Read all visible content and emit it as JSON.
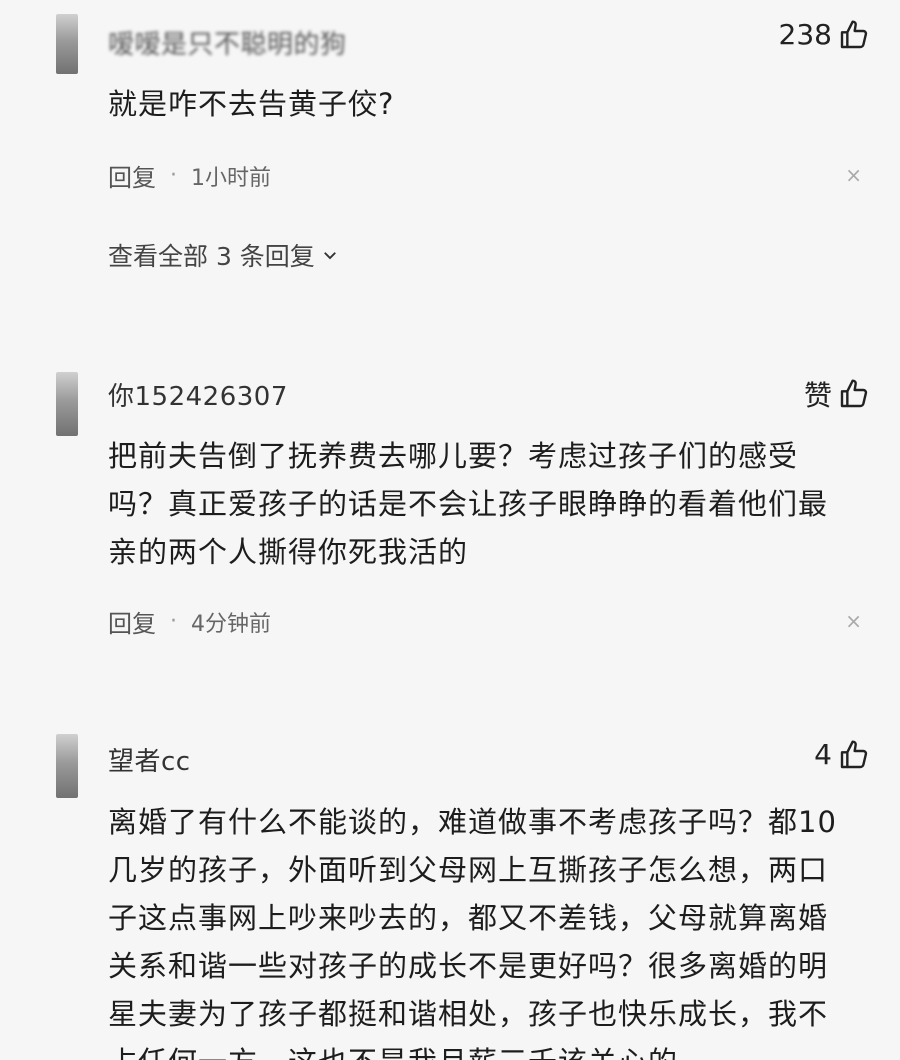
{
  "comments": [
    {
      "username": "嗳嗳是只不聪明的狗",
      "likes": "238",
      "text": "就是咋不去告黄子佼?",
      "reply_label": "回复",
      "time": "1小时前",
      "view_all": "查看全部 3 条回复"
    },
    {
      "username": "你152426307",
      "likes": "赞",
      "text": "把前夫告倒了抚养费去哪儿要？考虑过孩子们的感受吗？真正爱孩子的话是不会让孩子眼睁睁的看着他们最亲的两个人撕得你死我活的",
      "reply_label": "回复",
      "time": "4分钟前"
    },
    {
      "username": "望者cc",
      "likes": "4",
      "text": "离婚了有什么不能谈的，难道做事不考虑孩子吗？都10几岁的孩子，外面听到父母网上互撕孩子怎么想，两口子这点事网上吵来吵去的，都又不差钱，父母就算离婚关系和谐一些对孩子的成长不是更好吗？很多离婚的明星夫妻为了孩子都挺和谐相处，孩子也快乐成长，我不占任何一方，这也不是我月薪三千该关心的"
    }
  ],
  "close_symbol": "×"
}
